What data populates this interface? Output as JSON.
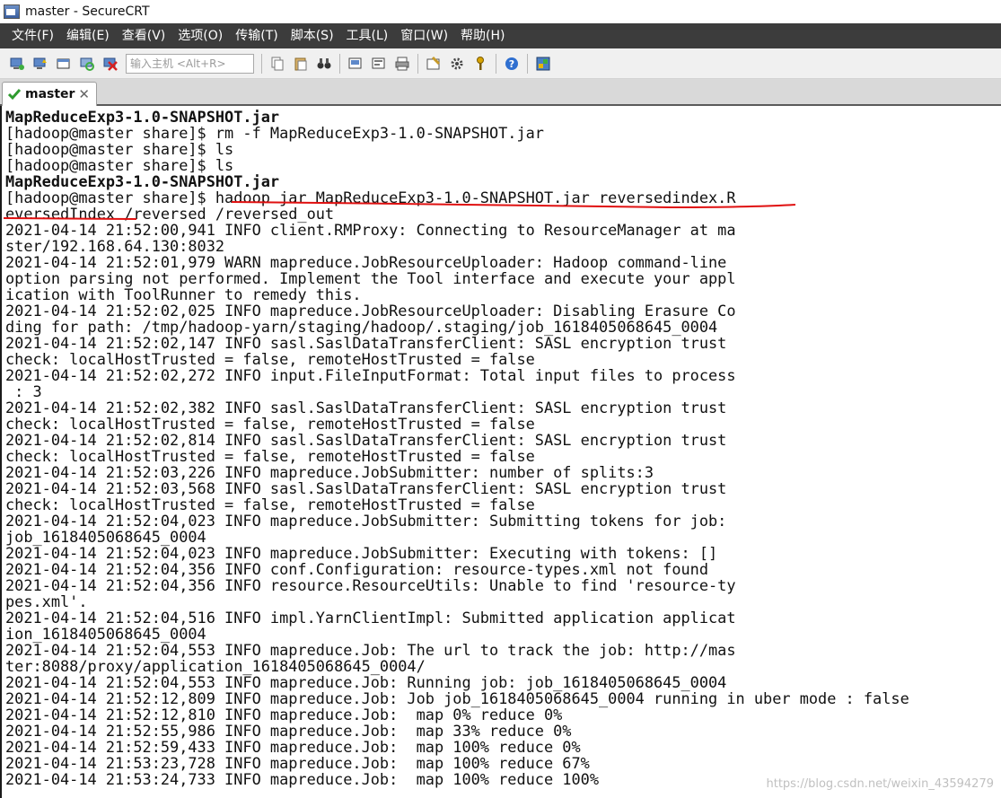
{
  "window": {
    "title": "master - SecureCRT"
  },
  "menu": [
    "文件(F)",
    "编辑(E)",
    "查看(V)",
    "选项(O)",
    "传输(T)",
    "脚本(S)",
    "工具(L)",
    "窗口(W)",
    "帮助(H)"
  ],
  "toolbar": {
    "host_placeholder": "输入主机 <Alt+R>"
  },
  "tab": {
    "label": "master"
  },
  "terminal": {
    "lines": [
      "MapReduceExp3-1.0-SNAPSHOT.jar",
      "[hadoop@master share]$ rm -f MapReduceExp3-1.0-SNAPSHOT.jar",
      "[hadoop@master share]$ ls",
      "[hadoop@master share]$ ls",
      "MapReduceExp3-1.0-SNAPSHOT.jar",
      "[hadoop@master share]$ hadoop jar MapReduceExp3-1.0-SNAPSHOT.jar reversedindex.R",
      "eversedIndex /reversed /reversed_out",
      "2021-04-14 21:52:00,941 INFO client.RMProxy: Connecting to ResourceManager at ma",
      "ster/192.168.64.130:8032",
      "2021-04-14 21:52:01,979 WARN mapreduce.JobResourceUploader: Hadoop command-line",
      "option parsing not performed. Implement the Tool interface and execute your appl",
      "ication with ToolRunner to remedy this.",
      "2021-04-14 21:52:02,025 INFO mapreduce.JobResourceUploader: Disabling Erasure Co",
      "ding for path: /tmp/hadoop-yarn/staging/hadoop/.staging/job_1618405068645_0004",
      "2021-04-14 21:52:02,147 INFO sasl.SaslDataTransferClient: SASL encryption trust",
      "check: localHostTrusted = false, remoteHostTrusted = false",
      "2021-04-14 21:52:02,272 INFO input.FileInputFormat: Total input files to process",
      " : 3",
      "2021-04-14 21:52:02,382 INFO sasl.SaslDataTransferClient: SASL encryption trust",
      "check: localHostTrusted = false, remoteHostTrusted = false",
      "2021-04-14 21:52:02,814 INFO sasl.SaslDataTransferClient: SASL encryption trust",
      "check: localHostTrusted = false, remoteHostTrusted = false",
      "2021-04-14 21:52:03,226 INFO mapreduce.JobSubmitter: number of splits:3",
      "2021-04-14 21:52:03,568 INFO sasl.SaslDataTransferClient: SASL encryption trust",
      "check: localHostTrusted = false, remoteHostTrusted = false",
      "2021-04-14 21:52:04,023 INFO mapreduce.JobSubmitter: Submitting tokens for job:",
      "job_1618405068645_0004",
      "2021-04-14 21:52:04,023 INFO mapreduce.JobSubmitter: Executing with tokens: []",
      "2021-04-14 21:52:04,356 INFO conf.Configuration: resource-types.xml not found",
      "2021-04-14 21:52:04,356 INFO resource.ResourceUtils: Unable to find 'resource-ty",
      "pes.xml'.",
      "2021-04-14 21:52:04,516 INFO impl.YarnClientImpl: Submitted application applicat",
      "ion_1618405068645_0004",
      "2021-04-14 21:52:04,553 INFO mapreduce.Job: The url to track the job: http://mas",
      "ter:8088/proxy/application_1618405068645_0004/",
      "2021-04-14 21:52:04,553 INFO mapreduce.Job: Running job: job_1618405068645_0004",
      "2021-04-14 21:52:12,809 INFO mapreduce.Job: Job job_1618405068645_0004 running in uber mode : false",
      "2021-04-14 21:52:12,810 INFO mapreduce.Job:  map 0% reduce 0%",
      "2021-04-14 21:52:55,986 INFO mapreduce.Job:  map 33% reduce 0%",
      "2021-04-14 21:52:59,433 INFO mapreduce.Job:  map 100% reduce 0%",
      "2021-04-14 21:53:23,728 INFO mapreduce.Job:  map 100% reduce 67%",
      "2021-04-14 21:53:24,733 INFO mapreduce.Job:  map 100% reduce 100%"
    ]
  },
  "watermark": "https://blog.csdn.net/weixin_43594279"
}
